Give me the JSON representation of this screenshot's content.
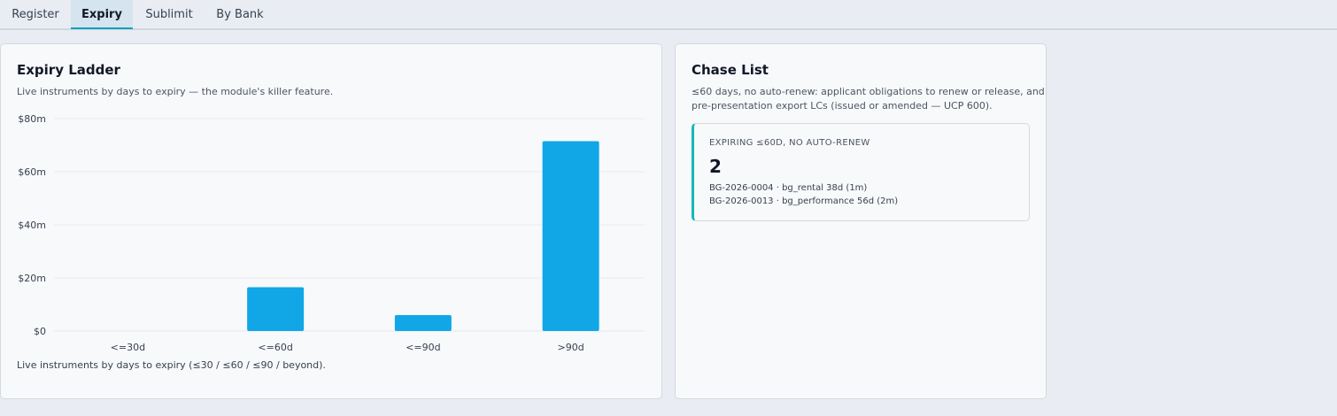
{
  "tabs": [
    {
      "label": "Register",
      "active": false
    },
    {
      "label": "Expiry",
      "active": true
    },
    {
      "label": "Sublimit",
      "active": false
    },
    {
      "label": "By Bank",
      "active": false
    }
  ],
  "ladder": {
    "title": "Expiry Ladder",
    "subtitle": "Live instruments by days to expiry — the module's killer feature.",
    "caption": "Live instruments by days to expiry (≤30 / ≤60 / ≤90 / beyond)."
  },
  "chart_data": {
    "type": "bar",
    "categories": [
      "<=30d",
      "<=60d",
      "<=90d",
      ">90d"
    ],
    "values": [
      0,
      16.5,
      6,
      71.5
    ],
    "y_ticks": [
      "$0",
      "$20m",
      "$40m",
      "$60m",
      "$80m"
    ],
    "y_tick_values": [
      0,
      20,
      40,
      60,
      80
    ],
    "ylim": [
      0,
      80
    ],
    "bar_color": "#11a7e7",
    "grid": true
  },
  "chase": {
    "title": "Chase List",
    "subtitle_line1": "≤60 days, no auto-renew: applicant obligations to renew or release, and",
    "subtitle_line2": "pre-presentation export LCs (issued or amended — UCP 600).",
    "box_heading": "EXPIRING ≤60D, NO AUTO-RENEW",
    "count": "2",
    "items": [
      "BG-2026-0004 · bg_rental 38d (1m)",
      "BG-2026-0013 · bg_performance 56d (2m)"
    ],
    "accent": "#14b8b8"
  }
}
